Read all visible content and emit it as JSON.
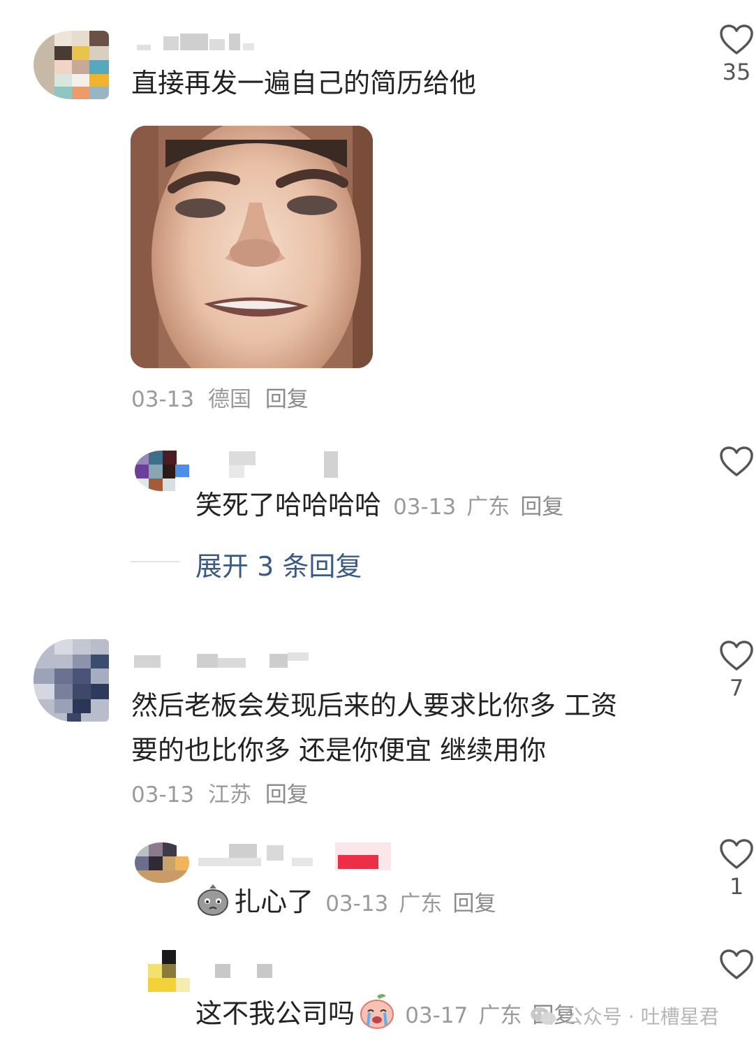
{
  "comments": [
    {
      "text": "直接再发一遍自己的简历给他",
      "date": "03-13",
      "region": "德国",
      "reply_label": "回复",
      "likes": "35",
      "image_alt": "smiling-face-meme"
    },
    {
      "text": "然后老板会发现后来的人要求比你多 工资要的也比你多 还是你便宜 继续用你",
      "text_line1": "然后老板会发现后来的人要求比你多 工资",
      "text_line2": "要的也比你多 还是你便宜 继续用你",
      "date": "03-13",
      "region": "江苏",
      "reply_label": "回复",
      "likes": "7"
    }
  ],
  "replies": [
    {
      "text": "笑死了哈哈哈哈",
      "date": "03-13",
      "region": "广东",
      "reply_label": "回复"
    },
    {
      "text": "扎心了",
      "emoji": "sad-bag-emoji",
      "date": "03-13",
      "region": "广东",
      "reply_label": "回复",
      "likes": "1"
    },
    {
      "text": "这不我公司吗",
      "emoji": "crying-peach-emoji",
      "date": "03-17",
      "region": "广东",
      "reply_label": "回复"
    }
  ],
  "expand_replies": "展开 3 条回复",
  "watermark": "公众号 · 吐槽星君",
  "colors": {
    "link_blue": "#3a5a86",
    "meta_gray": "#9a9a9a",
    "text": "#222222"
  }
}
